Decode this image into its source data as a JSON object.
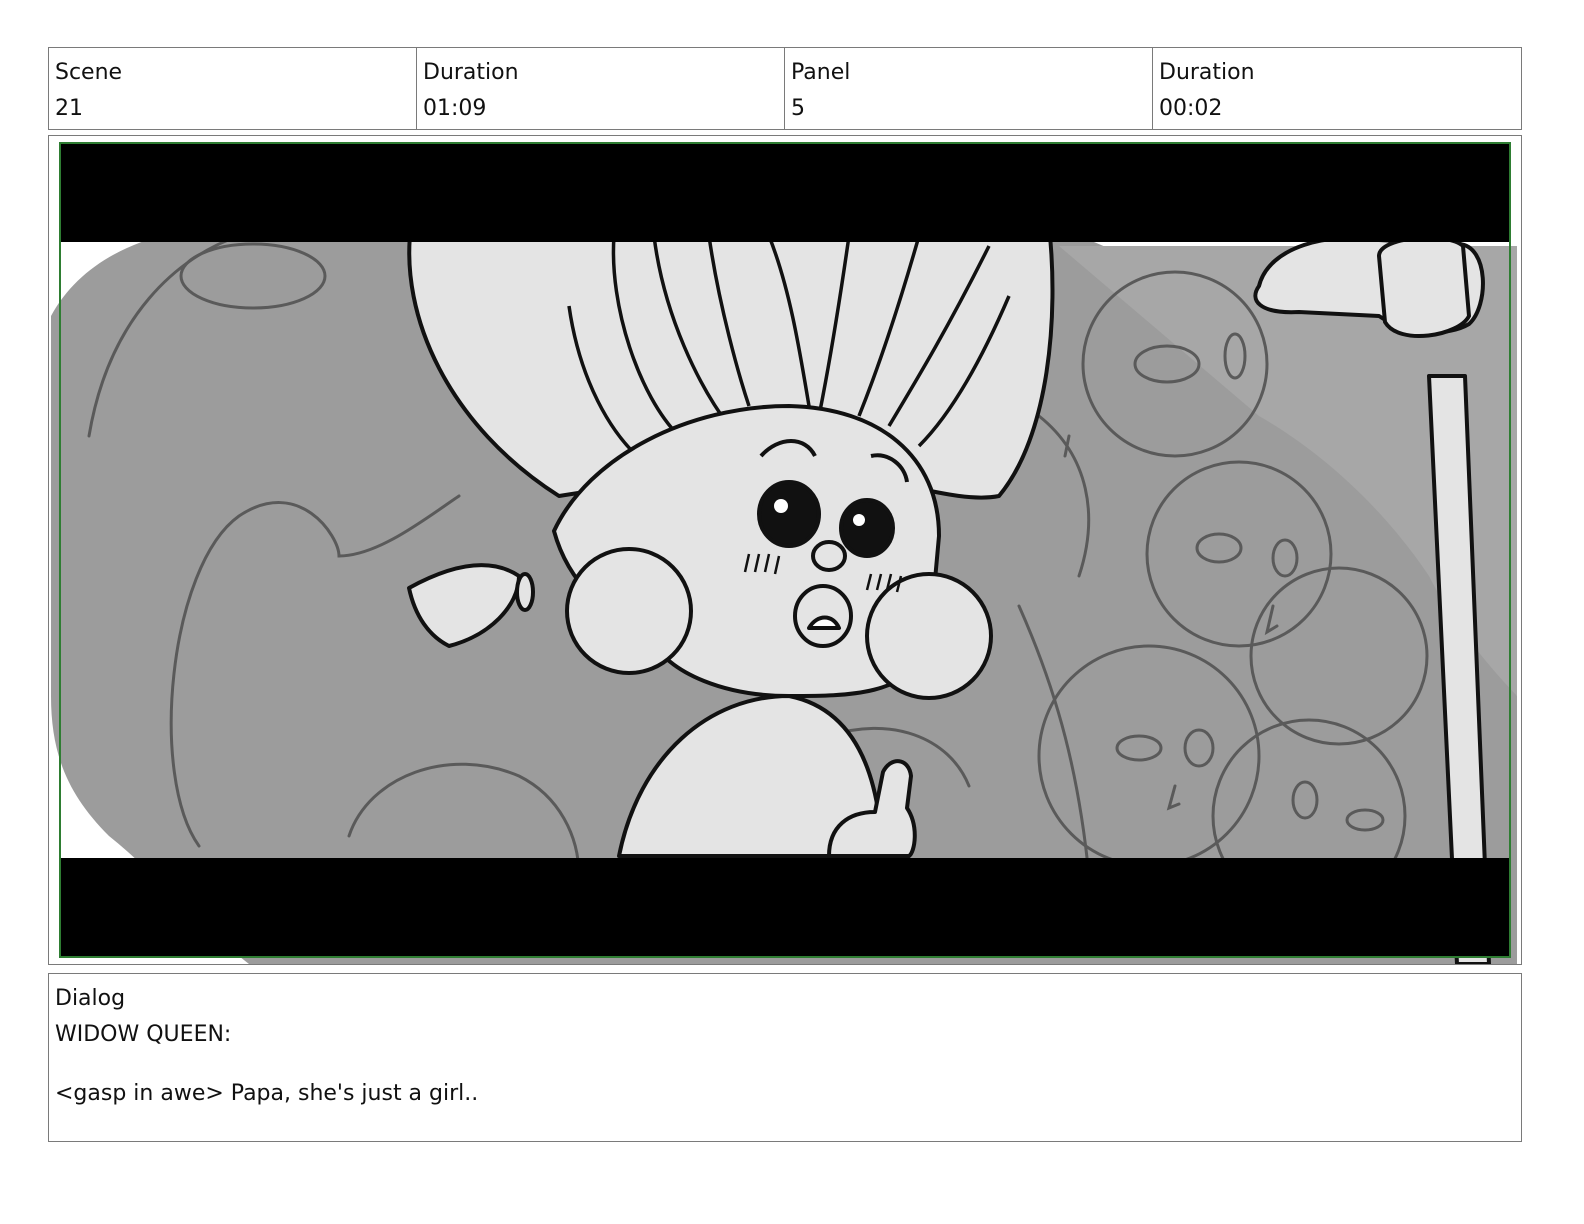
{
  "header": {
    "scene_label": "Scene",
    "scene_value": "21",
    "scene_duration_label": "Duration",
    "scene_duration_value": "01:09",
    "panel_label": "Panel",
    "panel_value": "5",
    "panel_duration_label": "Duration",
    "panel_duration_value": "00:02"
  },
  "panel_image": {
    "subject_icons": [
      "troll-girl-sketch",
      "skull-spirits-sketch",
      "staff-hand-sketch"
    ],
    "colors": {
      "letterbox": "#000000",
      "safe_frame": "#2e7d32",
      "background_gray": "#9a9a9a",
      "light_gray": "#e4e4e4"
    }
  },
  "dialog": {
    "label": "Dialog",
    "speaker": "WIDOW QUEEN:",
    "line": "<gasp in awe> Papa, she's just a girl.."
  }
}
